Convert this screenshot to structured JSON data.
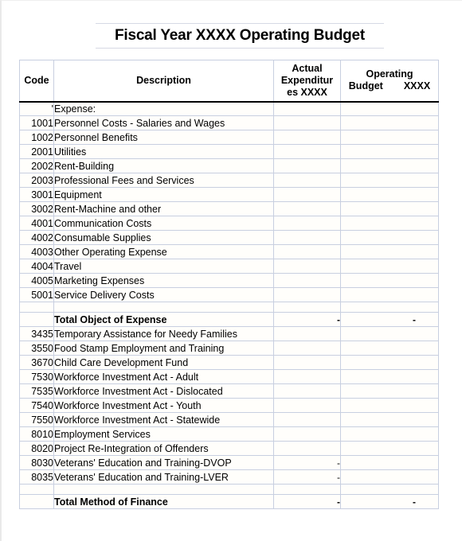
{
  "document": {
    "title": "Fiscal Year XXXX Operating Budget"
  },
  "table": {
    "columns": [
      {
        "key": "code",
        "label": "Code"
      },
      {
        "key": "desc",
        "label": "Description"
      },
      {
        "key": "act",
        "label_line1": "Actual",
        "label_line2": "Expenditur",
        "label_line3": "es XXXX"
      },
      {
        "key": "bud",
        "label_line1": "Operating",
        "label_line2a": "Budget",
        "label_line2b": "XXXX"
      }
    ],
    "rows": [
      {
        "code": "'",
        "desc": "Expense:",
        "act": "",
        "bud": "",
        "style": "section"
      },
      {
        "code": "1001",
        "desc": "Personnel Costs - Salaries and Wages",
        "act": "",
        "bud": ""
      },
      {
        "code": "1002",
        "desc": "Personnel Benefits",
        "act": "",
        "bud": ""
      },
      {
        "code": "2001",
        "desc": "Utilities",
        "act": "",
        "bud": ""
      },
      {
        "code": "2002",
        "desc": "Rent-Building",
        "act": "",
        "bud": ""
      },
      {
        "code": "2003",
        "desc": "Professional Fees and Services",
        "act": "",
        "bud": ""
      },
      {
        "code": "3001",
        "desc": "Equipment",
        "act": "",
        "bud": ""
      },
      {
        "code": "3002",
        "desc": "Rent-Machine and other",
        "act": "",
        "bud": ""
      },
      {
        "code": "4001",
        "desc": "Communication Costs",
        "act": "",
        "bud": ""
      },
      {
        "code": "4002",
        "desc": "Consumable Supplies",
        "act": "",
        "bud": ""
      },
      {
        "code": "4003",
        "desc": "Other Operating Expense",
        "act": "",
        "bud": ""
      },
      {
        "code": "4004",
        "desc": "Travel",
        "act": "",
        "bud": ""
      },
      {
        "code": "4005",
        "desc": "Marketing Expenses",
        "act": "",
        "bud": ""
      },
      {
        "code": "5001",
        "desc": "Service Delivery Costs",
        "act": "",
        "bud": ""
      },
      {
        "code": "",
        "desc": "",
        "act": "",
        "bud": "",
        "style": "spacer"
      },
      {
        "code": "",
        "desc": "Total Object of Expense",
        "act": "-",
        "bud": "-",
        "style": "total"
      },
      {
        "code": "3435",
        "desc": "Temporary Assistance for Needy Families",
        "act": "",
        "bud": ""
      },
      {
        "code": "3550",
        "desc": "Food Stamp Employment and Training",
        "act": "",
        "bud": ""
      },
      {
        "code": "3670",
        "desc": "Child Care Development Fund",
        "act": "",
        "bud": ""
      },
      {
        "code": "7530",
        "desc": "Workforce Investment Act - Adult",
        "act": "",
        "bud": ""
      },
      {
        "code": "7535",
        "desc": "Workforce Investment Act - Dislocated",
        "act": "",
        "bud": ""
      },
      {
        "code": "7540",
        "desc": "Workforce Investment Act - Youth",
        "act": "",
        "bud": ""
      },
      {
        "code": "7550",
        "desc": "Workforce Investment Act - Statewide",
        "act": "",
        "bud": ""
      },
      {
        "code": "8010",
        "desc": "Employment Services",
        "act": "",
        "bud": ""
      },
      {
        "code": "8020",
        "desc": "Project Re-Integration of Offenders",
        "act": "",
        "bud": ""
      },
      {
        "code": "8030",
        "desc": "Veterans' Education and Training-DVOP",
        "act": "-",
        "bud": ""
      },
      {
        "code": "8035",
        "desc": "Veterans' Education and Training-LVER",
        "act": "-",
        "bud": ""
      },
      {
        "code": "",
        "desc": "",
        "act": "",
        "bud": "",
        "style": "spacer"
      },
      {
        "code": "",
        "desc": "Total Method of Finance",
        "act": "-",
        "bud": "-",
        "style": "total"
      }
    ]
  },
  "colors": {
    "gridline": "#c8cfe0",
    "header_rule": "#000000",
    "cell_background": "#fffefb",
    "text": "#000000"
  }
}
